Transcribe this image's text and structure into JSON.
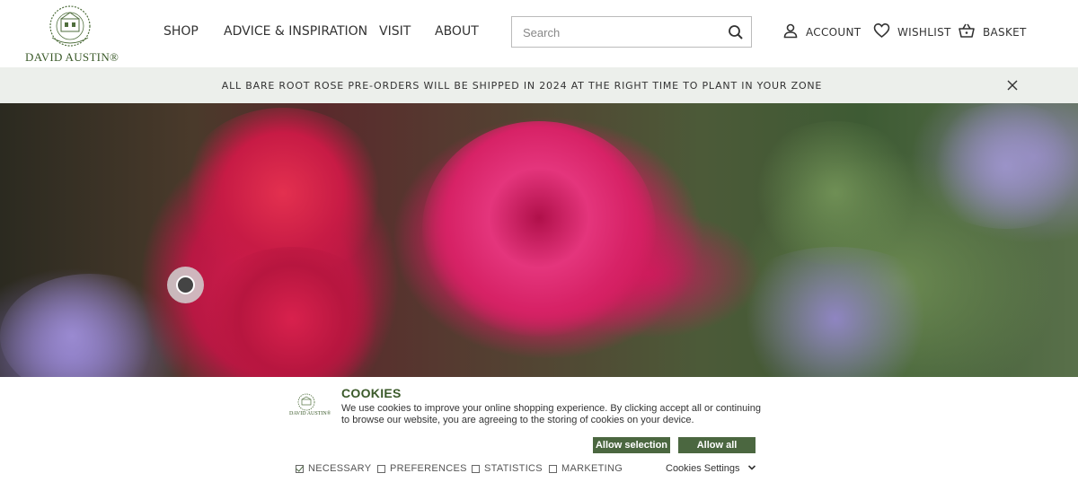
{
  "brand": {
    "name": "David Austin",
    "logo_text": "DAVID AUSTIN®"
  },
  "nav": {
    "items": [
      {
        "label": "SHOP"
      },
      {
        "label": "ADVICE & INSPIRATION"
      },
      {
        "label": "VISIT"
      },
      {
        "label": "ABOUT"
      }
    ]
  },
  "search": {
    "placeholder": "Search",
    "value": "",
    "icon": "search-icon"
  },
  "utility": {
    "account": {
      "label": "ACCOUNT",
      "icon": "user-icon"
    },
    "wishlist": {
      "label": "WISHLIST",
      "icon": "heart-icon"
    },
    "basket": {
      "label": "BASKET",
      "icon": "basket-icon"
    }
  },
  "banner": {
    "text": "ALL BARE ROOT ROSE PRE-ORDERS WILL BE SHIPPED IN 2024 AT THE RIGHT TIME TO PLANT IN YOUR ZONE",
    "close_icon": "close-icon"
  },
  "hero": {
    "image": "pink-rose-with-catmint-photo",
    "hotspot_icon": "hotspot-circle-icon"
  },
  "cookies": {
    "logo_text": "DAVID AUSTIN®",
    "title": "COOKIES",
    "body": "We use cookies to improve your online shopping experience. By clicking accept all or continuing to browse our website, you are agreeing to the storing of cookies on your device.",
    "allow_selection": "Allow selection",
    "allow_all": "Allow all",
    "options": [
      {
        "label": "NECESSARY",
        "checked": true
      },
      {
        "label": "PREFERENCES",
        "checked": false
      },
      {
        "label": "STATISTICS",
        "checked": false
      },
      {
        "label": "MARKETING",
        "checked": false
      }
    ],
    "settings_label": "Cookies Settings",
    "settings_icon": "chevron-down-icon"
  },
  "colors": {
    "brand_green": "#4b6740",
    "banner_bg": "#ecefeb",
    "logo_green": "#3b5a2a"
  }
}
